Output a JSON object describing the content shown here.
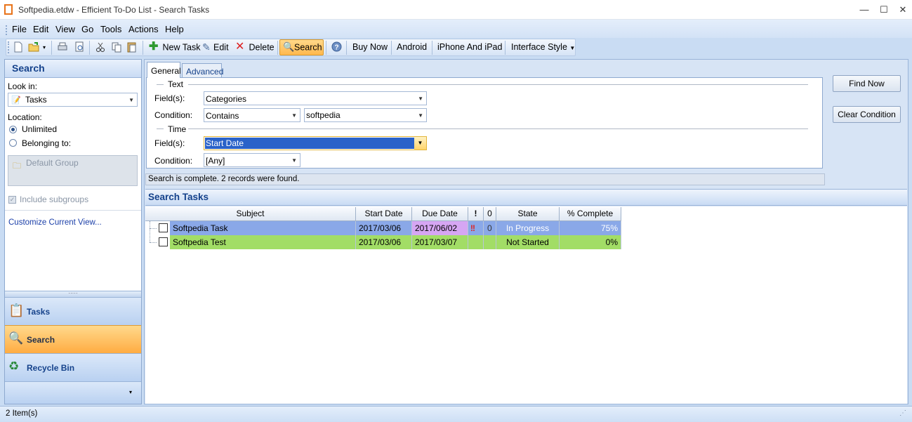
{
  "window": {
    "title": "Softpedia.etdw - Efficient To-Do List - Search Tasks",
    "min": "—",
    "max": "☐",
    "close": "✕"
  },
  "menu": [
    "File",
    "Edit",
    "View",
    "Go",
    "Tools",
    "Actions",
    "Help"
  ],
  "toolbar": {
    "new_task": "New Task",
    "edit": "Edit",
    "delete": "Delete",
    "search": "Search",
    "buy_now": "Buy Now",
    "android": "Android",
    "iphone": "iPhone And iPad",
    "interface_style": "Interface Style"
  },
  "left": {
    "title": "Search",
    "look_in_label": "Look in:",
    "look_in_value": "Tasks",
    "location_label": "Location:",
    "unlimited": "Unlimited",
    "belonging_to": "Belonging to:",
    "default_group": "Default Group",
    "include_subgroups": "Include subgroups",
    "customize": "Customize Current View...",
    "nav": {
      "tasks": "Tasks",
      "search": "Search",
      "recycle": "Recycle Bin"
    }
  },
  "criteria": {
    "tabs": {
      "general": "General",
      "advanced": "Advanced"
    },
    "text_section": "Text",
    "time_section": "Time",
    "fields_label": "Field(s):",
    "condition_label": "Condition:",
    "text_field": "Categories",
    "text_condition": "Contains",
    "text_value": "softpedia",
    "time_field": "Start Date",
    "time_condition": "[Any]",
    "find_now": "Find Now",
    "clear_condition": "Clear Condition",
    "status": "Search is complete. 2 records were found."
  },
  "results": {
    "title": "Search Tasks",
    "columns": [
      "Subject",
      "Start Date",
      "Due Date",
      "!",
      "0",
      "State",
      "% Complete"
    ],
    "rows": [
      {
        "subject": "Softpedia Task",
        "start": "2017/03/06",
        "due": "2017/06/02",
        "priority": "!!",
        "attach": "0",
        "state": "In Progress",
        "complete": "75%",
        "color": "#8aa8e8",
        "due_color": "#d6a6f3"
      },
      {
        "subject": "Softpedia Test",
        "start": "2017/03/06",
        "due": "2017/03/07",
        "priority": "",
        "attach": "",
        "state": "Not Started",
        "complete": "0%",
        "color": "#a2dd66",
        "due_color": "#a2dd66"
      }
    ]
  },
  "statusbar": {
    "items": "2 Item(s)"
  }
}
